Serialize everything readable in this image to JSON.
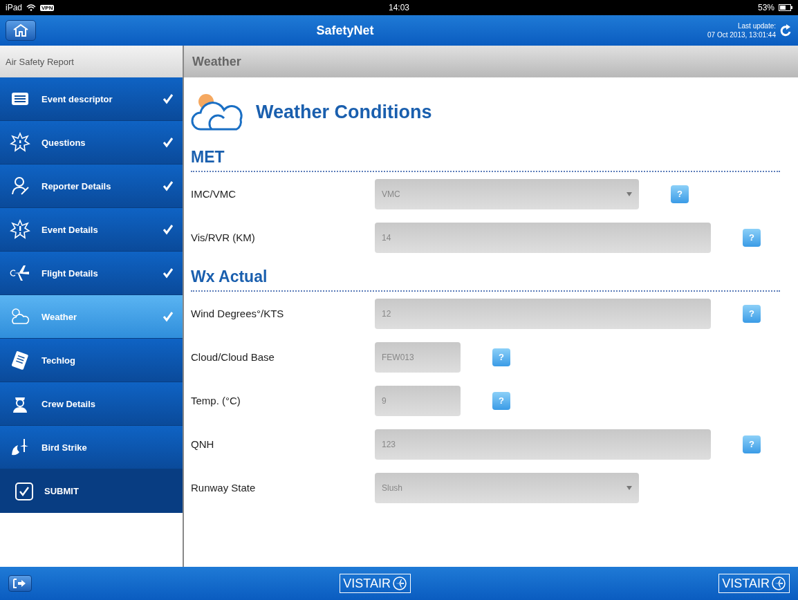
{
  "status_bar": {
    "device": "iPad",
    "vpn": "VPN",
    "time": "14:03",
    "battery": "53%"
  },
  "nav_bar": {
    "title": "SafetyNet",
    "update_label": "Last update:",
    "update_time": "07 Oct 2013, 13:01:44"
  },
  "sidebar": {
    "title": "Air Safety Report",
    "items": [
      {
        "label": "Event descriptor",
        "done": true,
        "selected": false
      },
      {
        "label": "Questions",
        "done": true,
        "selected": false
      },
      {
        "label": "Reporter Details",
        "done": true,
        "selected": false
      },
      {
        "label": "Event Details",
        "done": true,
        "selected": false
      },
      {
        "label": "Flight Details",
        "done": true,
        "selected": false
      },
      {
        "label": "Weather",
        "done": true,
        "selected": true
      },
      {
        "label": "Techlog",
        "done": false,
        "selected": false
      },
      {
        "label": "Crew Details",
        "done": false,
        "selected": false
      },
      {
        "label": "Bird Strike",
        "done": false,
        "selected": false
      }
    ],
    "submit": "SUBMIT"
  },
  "page": {
    "header": "Weather",
    "title": "Weather Conditions",
    "sections": [
      {
        "title": "MET",
        "fields": [
          {
            "label": "IMC/VMC",
            "kind": "select",
            "value": "VMC",
            "help": "?"
          },
          {
            "label": "Vis/RVR (KM)",
            "kind": "text",
            "value": "14",
            "help": "?"
          }
        ]
      },
      {
        "title": "Wx Actual",
        "fields": [
          {
            "label": "Wind Degrees°/KTS",
            "kind": "text",
            "value": "12",
            "help": "?"
          },
          {
            "label": "Cloud/Cloud Base",
            "kind": "short",
            "value": "FEW013",
            "help": "?"
          },
          {
            "label": "Temp. (°C)",
            "kind": "short",
            "value": "9",
            "help": "?"
          },
          {
            "label": "QNH",
            "kind": "text",
            "value": "123",
            "help": "?"
          },
          {
            "label": "Runway State",
            "kind": "select",
            "value": "Slush"
          }
        ]
      }
    ]
  },
  "bottom_bar": {
    "logos": [
      "VISTAIR",
      "VISTAIR"
    ]
  }
}
